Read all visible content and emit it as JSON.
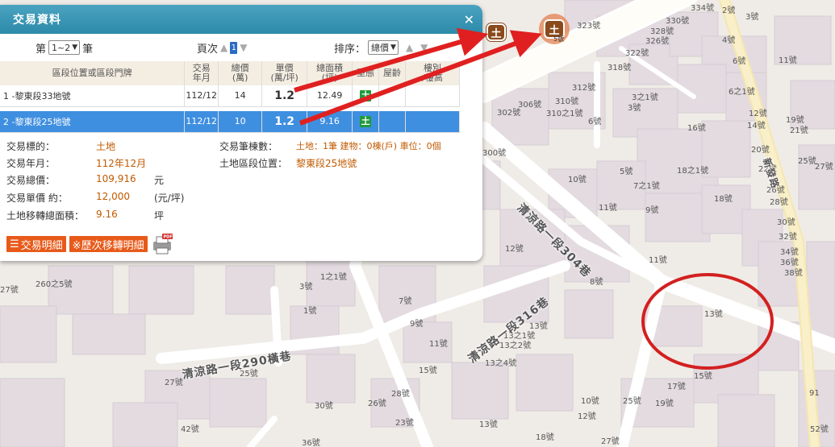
{
  "panel": {
    "title": "交易資料",
    "close_icon": "✕",
    "pager": {
      "count_prefix": "第",
      "count_select": "1~2",
      "count_suffix": "筆",
      "page_label": "頁次",
      "page_current": "1",
      "sort_label": "排序：",
      "sort_select": "總價"
    },
    "table": {
      "headers": [
        "區段位置或區段門牌",
        "交易\n年月",
        "總價\n(萬)",
        "單價\n(萬/坪)",
        "總面積\n(坪)",
        "型態",
        "屋齡",
        "樓別\n/樓高"
      ],
      "rows": [
        {
          "location": "1 -黎東段33地號",
          "date": "112/12",
          "total": "14",
          "unit": "1.2",
          "area": "12.49",
          "type_icon": "土",
          "selected": false
        },
        {
          "location": "2 -黎東段25地號",
          "date": "112/12",
          "total": "10",
          "unit": "1.2",
          "area": "9.16",
          "type_icon": "土",
          "selected": true
        }
      ]
    },
    "detail": {
      "target_label": "交易標的：",
      "target_value": "土地",
      "date_label": "交易年月：",
      "date_value": "112年12月",
      "total_label": "交易總價：",
      "total_value": "109,916",
      "total_unit": "元",
      "unit_label": "交易單價 約：",
      "unit_value": "12,000",
      "unit_unit": "(元/坪)",
      "area_label": "土地移轉總面積：",
      "area_value": "9.16",
      "area_unit": "坪",
      "count_label": "交易筆棟數：",
      "count_value": "土地：1筆 建物：0棟(戶) 車位：0個",
      "location_label": "土地區段位置：",
      "location_value": "黎東段25地號"
    },
    "buttons": {
      "detail_btn": "交易明細",
      "history_btn": "※歷次移轉明細"
    }
  },
  "map": {
    "markers": {
      "small": "土",
      "big": "土",
      "big_sub": "5號"
    },
    "roads": [
      "清涼路一段304巷",
      "清涼路一段316巷",
      "清涼路一段290橫巷",
      "新發路"
    ],
    "labels": [
      "334號",
      "2號",
      "3號",
      "323號",
      "330號",
      "328號",
      "326號",
      "4號",
      "322號",
      "6號",
      "11號",
      "318號",
      "312號",
      "306號",
      "310號",
      "302號",
      "310之1號",
      "6號",
      "3之1號",
      "3號",
      "6之1號",
      "12號",
      "14號",
      "19號",
      "21號",
      "16號",
      "20號",
      "25號",
      "27號",
      "22號",
      "300號",
      "10號",
      "5號",
      "18之1號",
      "7之1號",
      "26號",
      "28號",
      "18號",
      "11號",
      "9號",
      "30號",
      "32號",
      "34號",
      "36號",
      "38號",
      "12號",
      "11號",
      "13號",
      "1之1號",
      "8號",
      "3號",
      "7號",
      "260之5號",
      "1號",
      "9號",
      "13號",
      "13之1號",
      "13之2號",
      "11號",
      "13之4號",
      "15號",
      "17號",
      "25號",
      "15號",
      "27號",
      "30號",
      "26號",
      "28號",
      "10號",
      "25號",
      "19號",
      "12號",
      "13號",
      "23號",
      "18號",
      "27號",
      "42號",
      "36號",
      "52號",
      "91",
      "27號"
    ]
  },
  "colors": {
    "header": "#2c8aa9",
    "selected_row": "#3f8fe0",
    "value_text": "#c15a00",
    "button": "#e85a1a",
    "annotation": "#e02020"
  }
}
